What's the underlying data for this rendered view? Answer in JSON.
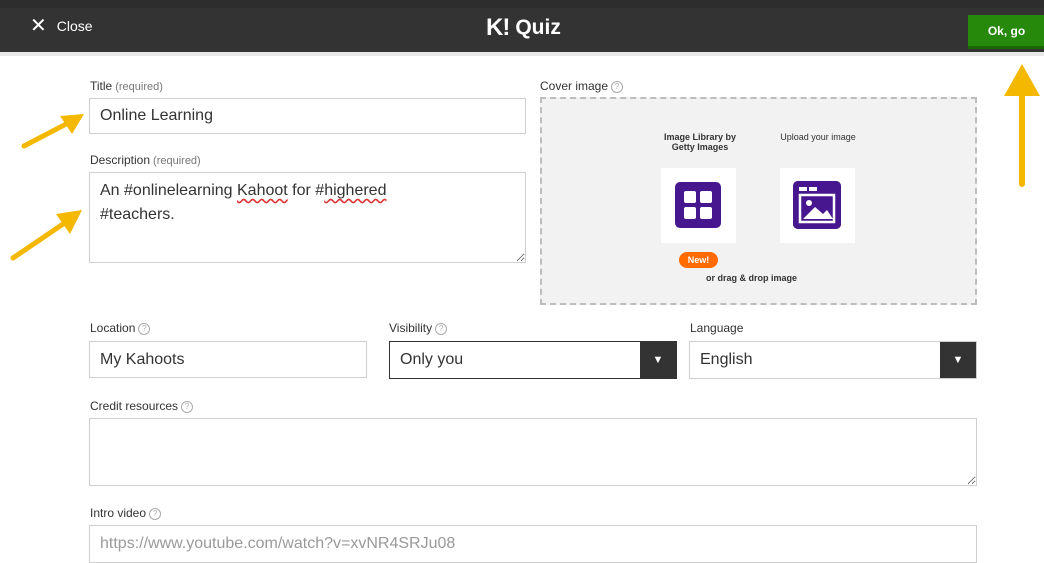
{
  "topbar": {
    "close_label": "Close",
    "brand_mark": "K!",
    "brand_text": "Quiz",
    "ok_label": "Ok, go"
  },
  "form": {
    "title": {
      "label": "Title",
      "required": "(required)",
      "value": "Online Learning"
    },
    "description": {
      "label": "Description",
      "required": "(required)",
      "line1_a": "An #onlinelearning ",
      "line1_b": "Kahoot",
      "line1_c": " for #",
      "line1_d": "highered",
      "line2": "#teachers."
    },
    "cover": {
      "label": "Cover image",
      "library_label": "Image Library by Getty Images",
      "upload_label": "Upload your image",
      "new_badge": "New!",
      "drag_text": "or drag & drop image"
    },
    "location": {
      "label": "Location",
      "value": "My Kahoots"
    },
    "visibility": {
      "label": "Visibility",
      "value": "Only you"
    },
    "language": {
      "label": "Language",
      "value": "English"
    },
    "credit": {
      "label": "Credit resources",
      "value": ""
    },
    "intro_video": {
      "label": "Intro video",
      "placeholder": "https://www.youtube.com/watch?v=xvNR4SRJu08"
    }
  },
  "colors": {
    "topbar": "#333333",
    "ok_button": "#26890c",
    "icon_purple": "#46178f",
    "badge_orange": "#ff6b00",
    "annotation_arrow": "#f5b800"
  },
  "icons": [
    "close-icon",
    "help-icon",
    "image-library-icon",
    "upload-image-icon",
    "caret-down-icon",
    "annotation-arrow"
  ]
}
